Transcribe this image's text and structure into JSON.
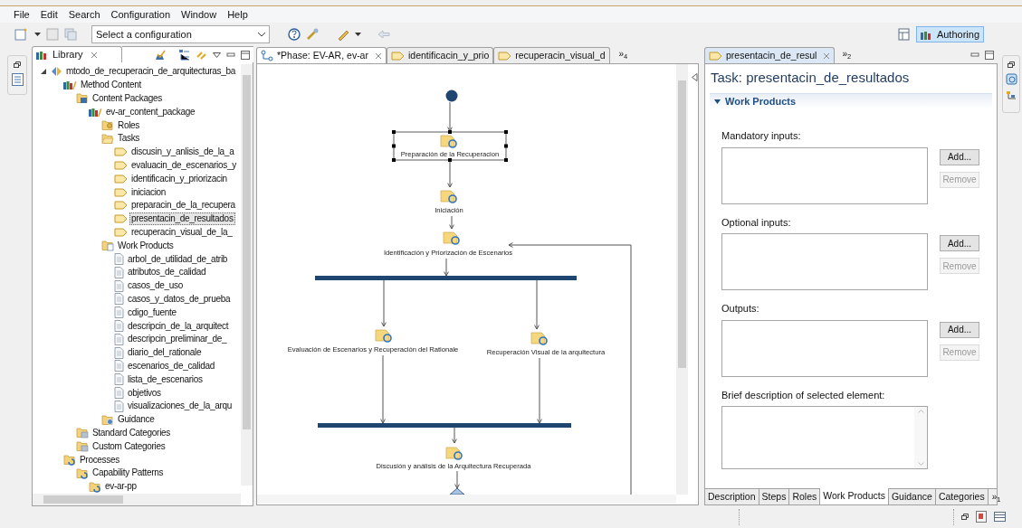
{
  "menu": [
    "File",
    "Edit",
    "Search",
    "Configuration",
    "Window",
    "Help"
  ],
  "toolbar": {
    "config_select": {
      "value": "Select a configuration"
    },
    "perspective": {
      "label": "Authoring",
      "selected": true
    }
  },
  "library": {
    "tab": "Library",
    "tree": [
      {
        "label": "mtodo_de_recuperacin_de_arquitecturas_ba",
        "kind": "plugin",
        "expanded": true,
        "selected": false,
        "children": [
          {
            "label": "Method Content",
            "kind": "content",
            "selected": false,
            "children": [
              {
                "label": "Content Packages",
                "kind": "packages",
                "selected": false,
                "children": [
                  {
                    "label": "ev-ar_content_package",
                    "kind": "package",
                    "selected": false,
                    "children": [
                      {
                        "label": "Roles",
                        "kind": "roles",
                        "selected": false
                      },
                      {
                        "label": "Tasks",
                        "kind": "tasks",
                        "selected": false,
                        "children": [
                          {
                            "label": "discusin_y_anlisis_de_la_a",
                            "kind": "task",
                            "selected": false
                          },
                          {
                            "label": "evaluacin_de_escenarios_y",
                            "kind": "task",
                            "selected": false
                          },
                          {
                            "label": "identificacin_y_priorizacin",
                            "kind": "task",
                            "selected": false
                          },
                          {
                            "label": "iniciacion",
                            "kind": "task",
                            "selected": false
                          },
                          {
                            "label": "preparacin_de_la_recupera",
                            "kind": "task",
                            "selected": false
                          },
                          {
                            "label": "presentacin_de_resultados",
                            "kind": "task",
                            "selected": true
                          },
                          {
                            "label": "recuperacin_visual_de_la_",
                            "kind": "task",
                            "selected": false
                          }
                        ]
                      },
                      {
                        "label": "Work Products",
                        "kind": "workproducts",
                        "selected": false,
                        "children": [
                          {
                            "label": "arbol_de_utilidad_de_atrib",
                            "kind": "artifact",
                            "selected": false
                          },
                          {
                            "label": "atributos_de_calidad",
                            "kind": "artifact",
                            "selected": false
                          },
                          {
                            "label": "casos_de_uso",
                            "kind": "artifact",
                            "selected": false
                          },
                          {
                            "label": "casos_y_datos_de_prueba",
                            "kind": "artifact",
                            "selected": false
                          },
                          {
                            "label": "cdigo_fuente",
                            "kind": "artifact",
                            "selected": false
                          },
                          {
                            "label": "descripcin_de_la_arquitect",
                            "kind": "artifact",
                            "selected": false
                          },
                          {
                            "label": "descripcin_preliminar_de_",
                            "kind": "artifact",
                            "selected": false
                          },
                          {
                            "label": "diario_del_rationale",
                            "kind": "artifact",
                            "selected": false
                          },
                          {
                            "label": "escenarios_de_calidad",
                            "kind": "artifact",
                            "selected": false
                          },
                          {
                            "label": "lista_de_escenarios",
                            "kind": "artifact",
                            "selected": false
                          },
                          {
                            "label": "objetivos",
                            "kind": "artifact",
                            "selected": false
                          },
                          {
                            "label": "visualizaciones_de_la_arqu",
                            "kind": "artifact",
                            "selected": false
                          }
                        ]
                      },
                      {
                        "label": "Guidance",
                        "kind": "guidance",
                        "selected": false
                      }
                    ]
                  }
                ]
              },
              {
                "label": "Standard Categories",
                "kind": "categories",
                "selected": false
              },
              {
                "label": "Custom Categories",
                "kind": "categories",
                "selected": false
              }
            ]
          },
          {
            "label": "Processes",
            "kind": "processes",
            "selected": false,
            "children": [
              {
                "label": "Capability Patterns",
                "kind": "patterns",
                "selected": false,
                "children": [
                  {
                    "label": "ev-ar-pp",
                    "kind": "pattern",
                    "selected": false
                  }
                ]
              }
            ]
          }
        ]
      }
    ]
  },
  "editor": {
    "tabs": [
      {
        "label": "*Phase: EV-AR, ev-ar",
        "kind": "phase",
        "selected": true
      },
      {
        "label": "identificacin_y_prio",
        "kind": "task",
        "selected": false
      },
      {
        "label": "recuperacin_visual_d",
        "kind": "task",
        "selected": false
      }
    ],
    "overflow": "»$_{4}$",
    "diagram": {
      "activities": [
        {
          "label": "Preparación de la Recuperacion",
          "selected": true
        },
        {
          "label": "Iniciación",
          "selected": false
        },
        {
          "label": "Identificación y Priorización de Escenarios",
          "selected": false
        },
        {
          "label": "Evaluación de Escenarios y Recuperación del Rationale",
          "selected": false
        },
        {
          "label": "Recuperación Visual de la arquitectura",
          "selected": false
        },
        {
          "label": "Discusión y análisis de la Arquitectura Recuperada",
          "selected": false
        }
      ]
    }
  },
  "properties": {
    "tab": "presentacin_de_resul",
    "overflow": "»$_{2}$",
    "title": "Task: presentacin_de_resultados",
    "section": {
      "title": "Work Products",
      "expanded": true
    },
    "lists": [
      {
        "label": "Mandatory inputs:",
        "buttons": [
          {
            "label": "Add...",
            "disabled": false
          },
          {
            "label": "Remove",
            "disabled": true
          }
        ]
      },
      {
        "label": "Optional inputs:",
        "buttons": [
          {
            "label": "Add...",
            "disabled": false
          },
          {
            "label": "Remove",
            "disabled": true
          }
        ]
      },
      {
        "label": "Outputs:",
        "buttons": [
          {
            "label": "Add...",
            "disabled": false
          },
          {
            "label": "Remove",
            "disabled": true
          }
        ]
      }
    ],
    "description": {
      "label": "Brief description of selected element:"
    },
    "bottom_tabs": [
      {
        "label": "Description",
        "selected": false
      },
      {
        "label": "Steps",
        "selected": false
      },
      {
        "label": "Roles",
        "selected": false
      },
      {
        "label": "Work Products",
        "selected": true
      },
      {
        "label": "Guidance",
        "selected": false
      },
      {
        "label": "Categories",
        "selected": false
      }
    ],
    "bottom_overflow": "»$_{1}$"
  }
}
